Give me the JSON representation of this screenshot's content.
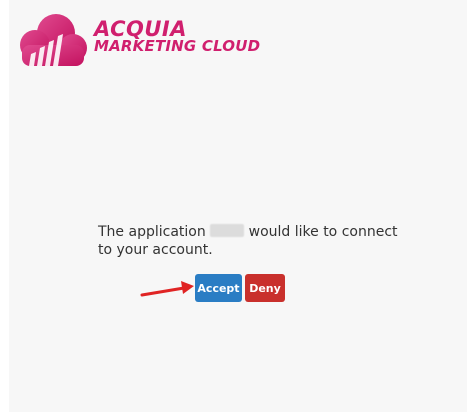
{
  "brand": {
    "line1": "ACQUIA",
    "line2": "MARKETING CLOUD",
    "logo_icon": "cloud-bars-logo",
    "color": "#d01f6e"
  },
  "auth": {
    "message_prefix": "The application",
    "message_suffix": "would like to connect to your account.",
    "accept_label": "Accept",
    "deny_label": "Deny",
    "accept_color": "#2a7dc4",
    "deny_color": "#c9302c",
    "annotation_arrow_color": "#e02424"
  }
}
